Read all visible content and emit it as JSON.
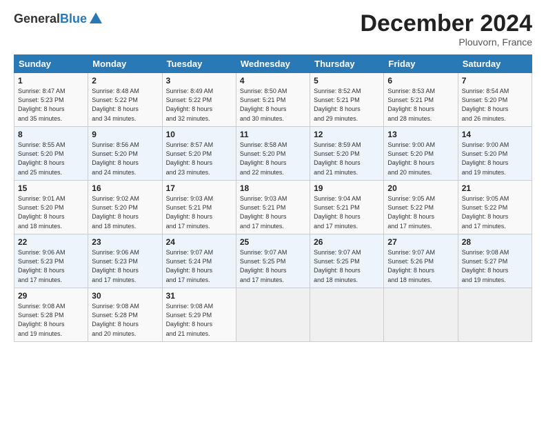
{
  "header": {
    "logo_general": "General",
    "logo_blue": "Blue",
    "month_title": "December 2024",
    "location": "Plouvorn, France"
  },
  "days_of_week": [
    "Sunday",
    "Monday",
    "Tuesday",
    "Wednesday",
    "Thursday",
    "Friday",
    "Saturday"
  ],
  "weeks": [
    [
      {
        "day": "1",
        "info": "Sunrise: 8:47 AM\nSunset: 5:23 PM\nDaylight: 8 hours\nand 35 minutes."
      },
      {
        "day": "2",
        "info": "Sunrise: 8:48 AM\nSunset: 5:22 PM\nDaylight: 8 hours\nand 34 minutes."
      },
      {
        "day": "3",
        "info": "Sunrise: 8:49 AM\nSunset: 5:22 PM\nDaylight: 8 hours\nand 32 minutes."
      },
      {
        "day": "4",
        "info": "Sunrise: 8:50 AM\nSunset: 5:21 PM\nDaylight: 8 hours\nand 30 minutes."
      },
      {
        "day": "5",
        "info": "Sunrise: 8:52 AM\nSunset: 5:21 PM\nDaylight: 8 hours\nand 29 minutes."
      },
      {
        "day": "6",
        "info": "Sunrise: 8:53 AM\nSunset: 5:21 PM\nDaylight: 8 hours\nand 28 minutes."
      },
      {
        "day": "7",
        "info": "Sunrise: 8:54 AM\nSunset: 5:20 PM\nDaylight: 8 hours\nand 26 minutes."
      }
    ],
    [
      {
        "day": "8",
        "info": "Sunrise: 8:55 AM\nSunset: 5:20 PM\nDaylight: 8 hours\nand 25 minutes."
      },
      {
        "day": "9",
        "info": "Sunrise: 8:56 AM\nSunset: 5:20 PM\nDaylight: 8 hours\nand 24 minutes."
      },
      {
        "day": "10",
        "info": "Sunrise: 8:57 AM\nSunset: 5:20 PM\nDaylight: 8 hours\nand 23 minutes."
      },
      {
        "day": "11",
        "info": "Sunrise: 8:58 AM\nSunset: 5:20 PM\nDaylight: 8 hours\nand 22 minutes."
      },
      {
        "day": "12",
        "info": "Sunrise: 8:59 AM\nSunset: 5:20 PM\nDaylight: 8 hours\nand 21 minutes."
      },
      {
        "day": "13",
        "info": "Sunrise: 9:00 AM\nSunset: 5:20 PM\nDaylight: 8 hours\nand 20 minutes."
      },
      {
        "day": "14",
        "info": "Sunrise: 9:00 AM\nSunset: 5:20 PM\nDaylight: 8 hours\nand 19 minutes."
      }
    ],
    [
      {
        "day": "15",
        "info": "Sunrise: 9:01 AM\nSunset: 5:20 PM\nDaylight: 8 hours\nand 18 minutes."
      },
      {
        "day": "16",
        "info": "Sunrise: 9:02 AM\nSunset: 5:20 PM\nDaylight: 8 hours\nand 18 minutes."
      },
      {
        "day": "17",
        "info": "Sunrise: 9:03 AM\nSunset: 5:21 PM\nDaylight: 8 hours\nand 17 minutes."
      },
      {
        "day": "18",
        "info": "Sunrise: 9:03 AM\nSunset: 5:21 PM\nDaylight: 8 hours\nand 17 minutes."
      },
      {
        "day": "19",
        "info": "Sunrise: 9:04 AM\nSunset: 5:21 PM\nDaylight: 8 hours\nand 17 minutes."
      },
      {
        "day": "20",
        "info": "Sunrise: 9:05 AM\nSunset: 5:22 PM\nDaylight: 8 hours\nand 17 minutes."
      },
      {
        "day": "21",
        "info": "Sunrise: 9:05 AM\nSunset: 5:22 PM\nDaylight: 8 hours\nand 17 minutes."
      }
    ],
    [
      {
        "day": "22",
        "info": "Sunrise: 9:06 AM\nSunset: 5:23 PM\nDaylight: 8 hours\nand 17 minutes."
      },
      {
        "day": "23",
        "info": "Sunrise: 9:06 AM\nSunset: 5:23 PM\nDaylight: 8 hours\nand 17 minutes."
      },
      {
        "day": "24",
        "info": "Sunrise: 9:07 AM\nSunset: 5:24 PM\nDaylight: 8 hours\nand 17 minutes."
      },
      {
        "day": "25",
        "info": "Sunrise: 9:07 AM\nSunset: 5:25 PM\nDaylight: 8 hours\nand 17 minutes."
      },
      {
        "day": "26",
        "info": "Sunrise: 9:07 AM\nSunset: 5:25 PM\nDaylight: 8 hours\nand 18 minutes."
      },
      {
        "day": "27",
        "info": "Sunrise: 9:07 AM\nSunset: 5:26 PM\nDaylight: 8 hours\nand 18 minutes."
      },
      {
        "day": "28",
        "info": "Sunrise: 9:08 AM\nSunset: 5:27 PM\nDaylight: 8 hours\nand 19 minutes."
      }
    ],
    [
      {
        "day": "29",
        "info": "Sunrise: 9:08 AM\nSunset: 5:28 PM\nDaylight: 8 hours\nand 19 minutes."
      },
      {
        "day": "30",
        "info": "Sunrise: 9:08 AM\nSunset: 5:28 PM\nDaylight: 8 hours\nand 20 minutes."
      },
      {
        "day": "31",
        "info": "Sunrise: 9:08 AM\nSunset: 5:29 PM\nDaylight: 8 hours\nand 21 minutes."
      },
      {
        "day": "",
        "info": ""
      },
      {
        "day": "",
        "info": ""
      },
      {
        "day": "",
        "info": ""
      },
      {
        "day": "",
        "info": ""
      }
    ]
  ]
}
